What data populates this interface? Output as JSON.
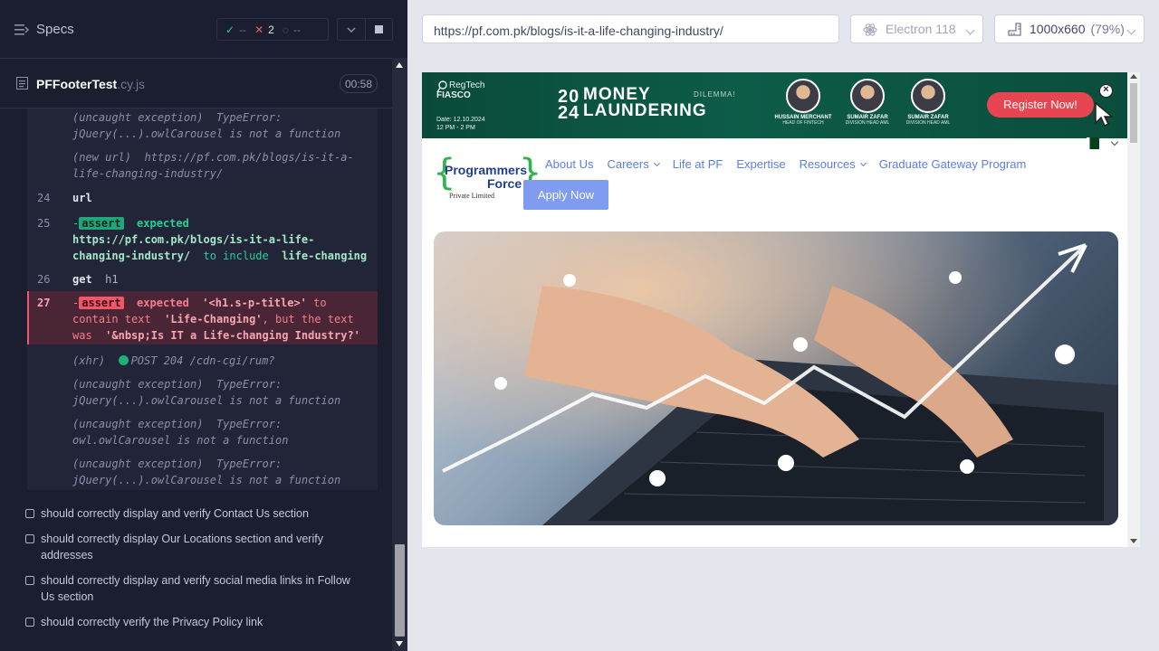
{
  "runner": {
    "specs_label": "Specs",
    "stats": {
      "passed": "--",
      "failed": "2",
      "pending": "--"
    },
    "spec_file": {
      "name": "PFFooterTest",
      "ext": ".cy.js",
      "duration": "00:58"
    }
  },
  "commands": [
    {
      "kind": "exception",
      "label": "(uncaught exception)",
      "message": "TypeError: jQuery(...).owlCarousel is not a function"
    },
    {
      "kind": "new_url",
      "label": "(new url)",
      "message": "https://pf.com.pk/blogs/is-it-a-life-changing-industry/"
    },
    {
      "num": "24",
      "name": "url",
      "arg": ""
    },
    {
      "num": "25",
      "dash": "-",
      "badge": "assert",
      "expected": "expected",
      "value": "https://pf.com.pk/blogs/is-it-a-life-changing-industry/",
      "verb": "to include",
      "target": "life-changing"
    },
    {
      "num": "26",
      "name": "get",
      "arg": "h1"
    },
    {
      "num": "27",
      "dash": "-",
      "badge": "assert",
      "expected": "expected",
      "value": "'<h1.s-p-title>'",
      "verb": "to contain text",
      "target": "'Life-Changing'",
      "rest": ", but the text was",
      "actual": "'&nbsp;Is IT a Life-changing Industry?'"
    },
    {
      "kind": "xhr",
      "label": "(xhr)",
      "message": "POST 204 /cdn-cgi/rum?"
    },
    {
      "kind": "exception",
      "label": "(uncaught exception)",
      "message": "TypeError: jQuery(...).owlCarousel is not a function"
    },
    {
      "kind": "exception",
      "label": "(uncaught exception)",
      "message": "TypeError: owl.owlCarousel is not a function"
    },
    {
      "kind": "exception",
      "label": "(uncaught exception)",
      "message": "TypeError: jQuery(...).owlCarousel is not a function"
    }
  ],
  "tests": [
    "should correctly display and verify Contact Us section",
    "should correctly display Our Locations section and verify addresses",
    "should correctly display and verify social media links in Follow Us section",
    "should correctly verify the Privacy Policy link"
  ],
  "aut": {
    "url": "https://pf.com.pk/blogs/is-it-a-life-changing-industry/",
    "browser": "Electron 118",
    "viewport": "1000x660",
    "scale": "(79%)"
  },
  "banner": {
    "regtech": "RegTech",
    "fiasco": "FIASCO",
    "date": "Date: 12.10.2024",
    "time": "12 PM - 2 PM",
    "year_top": "20",
    "year_bottom": "24",
    "money": "MONEY",
    "laundering": "LAUNDERING",
    "dilemma": "DILEMMA!",
    "speakers": [
      {
        "name": "HUSSAIN MERCHANT",
        "role": "HEAD OF FINTECH"
      },
      {
        "name": "SUMAIR ZAFAR",
        "role": "DIVISION HEAD AML"
      },
      {
        "name": "SUMAIR ZAFAR",
        "role": "DIVISION HEAD AML"
      }
    ],
    "register": "Register Now!"
  },
  "site": {
    "logo_line1": "Programmers",
    "logo_line2": "Force",
    "logo_line3": "Private Limited",
    "nav": [
      "About Us",
      "Careers",
      "Life at PF",
      "Expertise",
      "Resources",
      "Graduate Gateway Program"
    ],
    "apply": "Apply Now"
  },
  "colors": {
    "pass": "#1ea879",
    "fail": "#f0576a",
    "link": "#5b7ee6",
    "banner": "#0d5c48"
  }
}
